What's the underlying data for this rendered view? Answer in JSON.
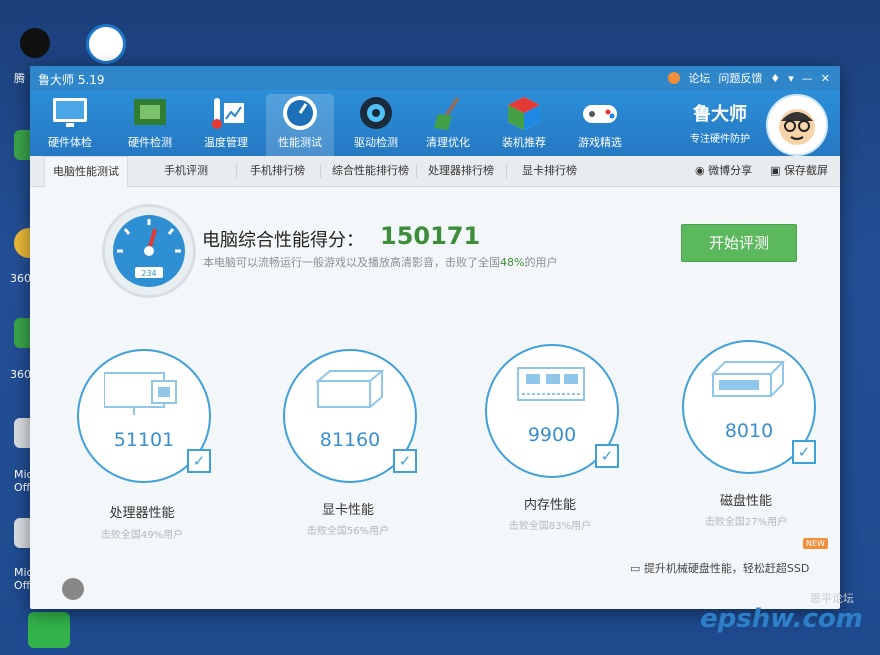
{
  "desktop": {
    "labels": [
      "腾",
      "360安",
      "360多",
      "Mic Offi",
      "Mic Offi"
    ]
  },
  "window": {
    "title": "鲁大师 5.19",
    "title_links": [
      "论坛",
      "问题反馈"
    ]
  },
  "toolbar": {
    "items": [
      {
        "label": "硬件体检",
        "icon": "monitor-icon"
      },
      {
        "label": "硬件检测",
        "icon": "circuit-board-icon"
      },
      {
        "label": "温度管理",
        "icon": "thermometer-icon"
      },
      {
        "label": "性能测试",
        "icon": "speedometer-icon"
      },
      {
        "label": "驱动检测",
        "icon": "gear-icon"
      },
      {
        "label": "清理优化",
        "icon": "broom-icon"
      },
      {
        "label": "装机推荐",
        "icon": "cube-icon"
      },
      {
        "label": "游戏精选",
        "icon": "gamepad-icon"
      }
    ],
    "brand_name": "鲁大师",
    "brand_slogan": "专注硬件防护"
  },
  "tabs": {
    "items": [
      "电脑性能测试",
      "手机评测",
      "手机排行榜",
      "综合性能排行榜",
      "处理器排行榜",
      "显卡排行榜"
    ],
    "share": "微博分享",
    "screenshot": "保存截屏"
  },
  "score": {
    "title": "电脑综合性能得分：",
    "value": "150171",
    "gauge_readout": "234",
    "sub_prefix": "本电脑可以流畅运行一般游戏以及播放高清影音，击败了全国",
    "sub_pct": "48%",
    "sub_suffix": "的用户",
    "start_button": "开始评测"
  },
  "cards": [
    {
      "name": "processor",
      "value": "51101",
      "label": "处理器性能",
      "sub": "击败全国49%用户"
    },
    {
      "name": "graphics",
      "value": "81160",
      "label": "显卡性能",
      "sub": "击败全国56%用户"
    },
    {
      "name": "memory",
      "value": "9900",
      "label": "内存性能",
      "sub": "击败全国83%用户"
    },
    {
      "name": "disk",
      "value": "8010",
      "label": "磁盘性能",
      "sub": "击败全国27%用户"
    }
  ],
  "ssd_promo": "提升机械硬盘性能，轻松赶超SSD",
  "new_badge": "NEW",
  "watermark": "epshw.com",
  "watermark_small": "恩平论坛",
  "colors": {
    "accent": "#2f86c9",
    "score": "#3d8d3a",
    "button": "#5bb85d",
    "ring": "#3fa0dc"
  }
}
